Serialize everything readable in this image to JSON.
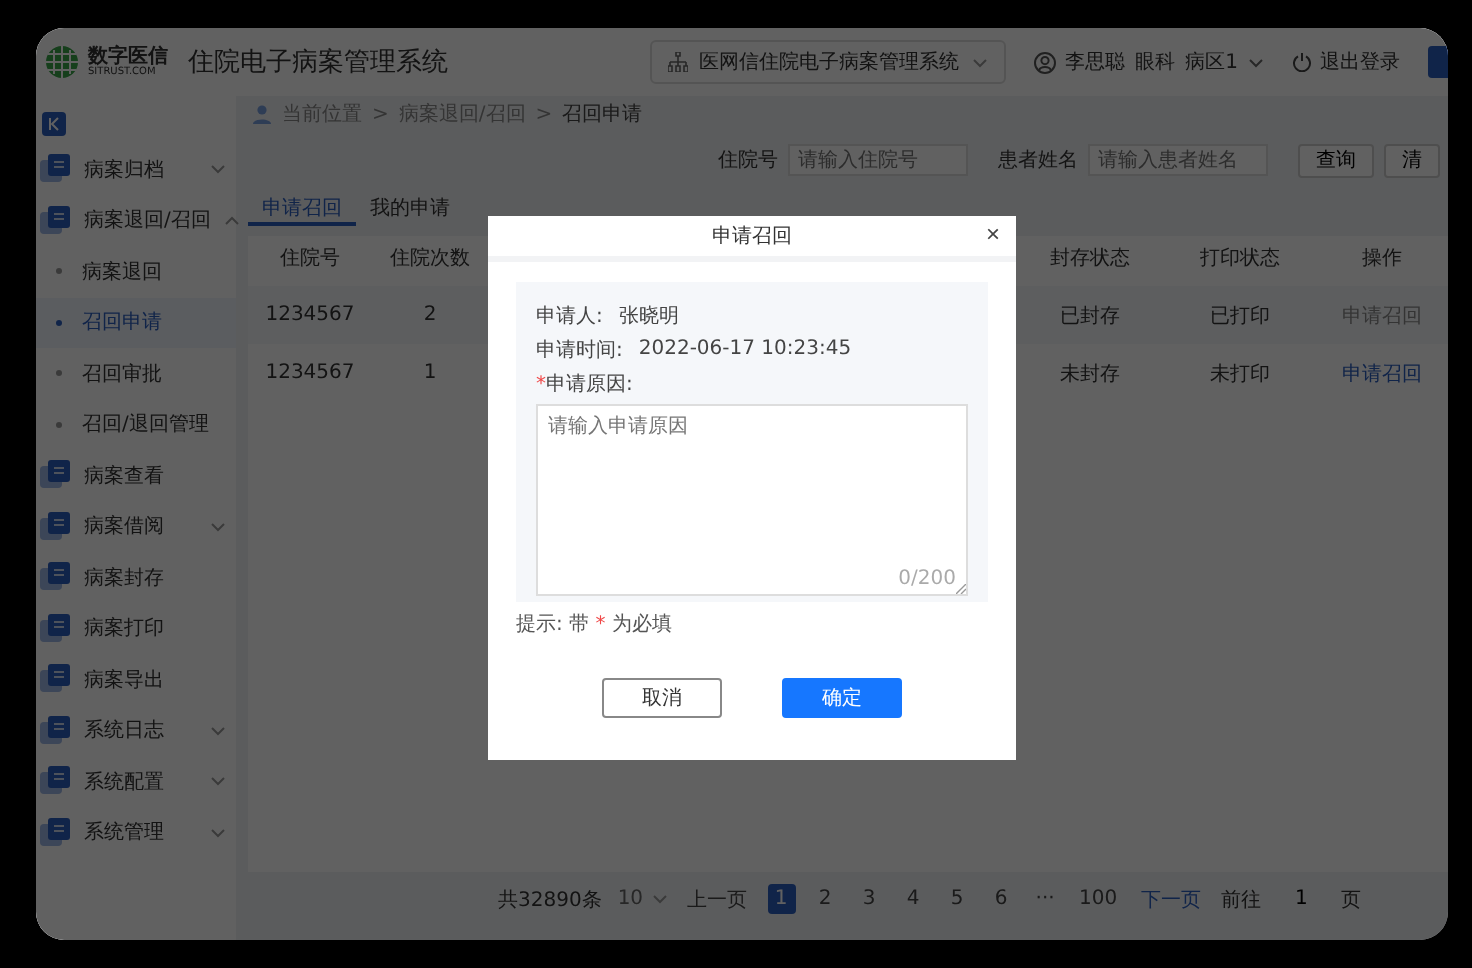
{
  "header": {
    "logo": {
      "name": "数字医信",
      "domain": "SITRUST.COM"
    },
    "title": "住院电子病案管理系统",
    "system_select": "医网信住院电子病案管理系统",
    "user": {
      "name": "李思聪",
      "department": "眼科",
      "ward": "病区1"
    },
    "logout": "退出登录"
  },
  "sidebar": {
    "items": [
      {
        "label": "病案归档",
        "expandable": true,
        "expanded": false
      },
      {
        "label": "病案退回/召回",
        "expandable": true,
        "expanded": true,
        "children": [
          {
            "label": "病案退回",
            "selected": false
          },
          {
            "label": "召回申请",
            "selected": true
          },
          {
            "label": "召回审批",
            "selected": false
          },
          {
            "label": "召回/退回管理",
            "selected": false
          }
        ]
      },
      {
        "label": "病案查看",
        "expandable": false
      },
      {
        "label": "病案借阅",
        "expandable": true,
        "expanded": false
      },
      {
        "label": "病案封存",
        "expandable": false
      },
      {
        "label": "病案打印",
        "expandable": false
      },
      {
        "label": "病案导出",
        "expandable": false
      },
      {
        "label": "系统日志",
        "expandable": true,
        "expanded": false
      },
      {
        "label": "系统配置",
        "expandable": true,
        "expanded": false
      },
      {
        "label": "系统管理",
        "expandable": true,
        "expanded": false
      }
    ]
  },
  "breadcrumb": {
    "items": [
      "当前位置",
      "病案退回/召回",
      "召回申请"
    ],
    "separator": ">"
  },
  "search": {
    "fields": [
      {
        "label": "住院号",
        "placeholder": "请输入住院号"
      },
      {
        "label": "患者姓名",
        "placeholder": "请输入患者姓名"
      }
    ],
    "buttons": [
      "查询",
      "清"
    ]
  },
  "tabs": [
    {
      "label": "申请召回",
      "selected": true
    },
    {
      "label": "我的申请",
      "selected": false
    }
  ],
  "table": {
    "columns": [
      "住院号",
      "住院次数",
      "封存状态",
      "打印状态",
      "操作"
    ],
    "rows": [
      {
        "cells": [
          "1234567",
          "2",
          "已封存",
          "已打印"
        ],
        "action": "申请召回",
        "disabled": true
      },
      {
        "cells": [
          "1234567",
          "1",
          "未封存",
          "未打印"
        ],
        "action": "申请召回",
        "disabled": false
      }
    ]
  },
  "pagination": {
    "total": "共32890条",
    "page_size": "10",
    "prev": "上一页",
    "pages": [
      {
        "label": "1",
        "selected": true
      },
      {
        "label": "2",
        "selected": false
      },
      {
        "label": "3",
        "selected": false
      },
      {
        "label": "4",
        "selected": false
      },
      {
        "label": "5",
        "selected": false
      },
      {
        "label": "6",
        "selected": false
      },
      {
        "label": "···",
        "selected": false
      },
      {
        "label": "100",
        "selected": false
      }
    ],
    "next": "下一页",
    "goto": "前往",
    "goto_value": "1",
    "goto_unit": "页"
  },
  "dialog": {
    "title": "申请召回",
    "close": "×",
    "applicant_label": "申请人:",
    "applicant": "张晓明",
    "time_label": "申请时间:",
    "time": "2022-06-17 10:23:45",
    "required_mark": "*",
    "reason_label": "申请原因:",
    "reason_placeholder": "请输入申请原因",
    "counter": "0/200",
    "hint_prefix": "提示: 带",
    "hint_mark": "*",
    "hint_suffix": "为必填",
    "cancel": "取消",
    "confirm": "确定"
  }
}
